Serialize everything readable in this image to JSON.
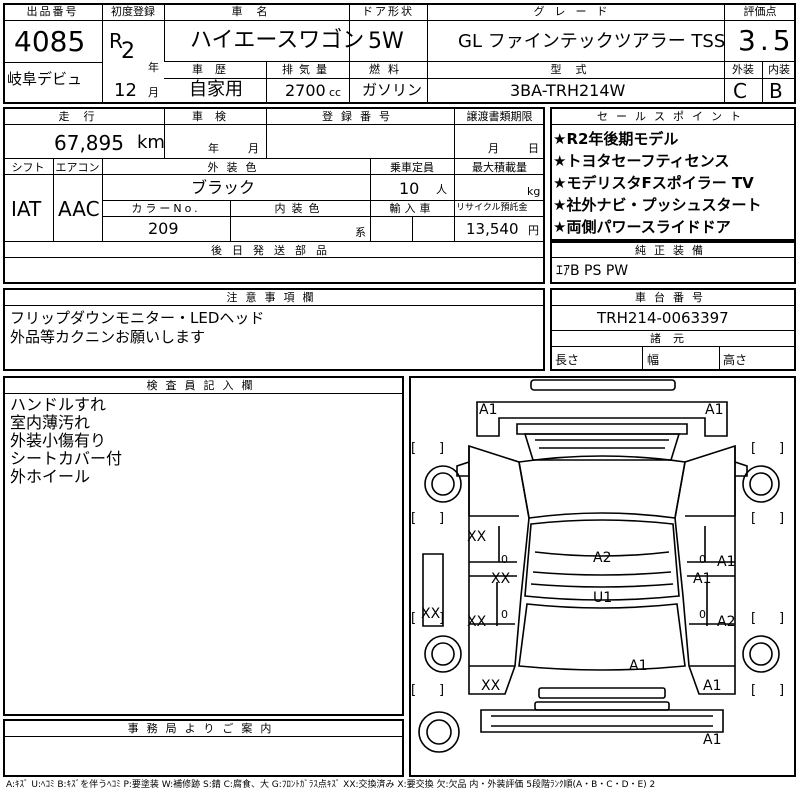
{
  "top": {
    "lot_label": "出品番号",
    "lot": "4085",
    "reg_label": "初度登録",
    "era": "R",
    "reg_year": "2",
    "year_unit": "年",
    "reg_month": "12",
    "month_unit": "月",
    "car_name_label": "車名",
    "car_name": "ハイエースワゴン",
    "door_label": "ドア形状",
    "door": "5W",
    "grade_label": "グレード",
    "grade": "GL ファインテックツアラー TSS",
    "score_label": "評価点",
    "score": "3.5",
    "venue": "岐阜デビュ",
    "history_label": "車歴",
    "history": "自家用",
    "displacement_label": "排気量",
    "displacement": "2700",
    "cc": "cc",
    "fuel_label": "燃料",
    "fuel": "ガソリン",
    "model_label": "型式",
    "model": "3BA-TRH214W",
    "exterior_label": "外装",
    "exterior": "C",
    "interior_label": "内装",
    "interior": "B"
  },
  "mid": {
    "mileage_label": "走行",
    "mileage": "67,895",
    "km": "km",
    "inspection_label": "車検",
    "insp_year_unit": "年",
    "insp_month_unit": "月",
    "plate_label": "登録番号",
    "transfer_label": "譲渡書類期限",
    "transfer_month_unit": "月",
    "transfer_day_unit": "日",
    "shift_label": "シフト",
    "shift": "IAT",
    "ac_label": "エアコン",
    "ac": "AAC",
    "color_label": "外装色",
    "color": "ブラック",
    "capacity_label": "乗車定員",
    "capacity": "10",
    "capacity_unit": "人",
    "load_label": "最大積載量",
    "load_unit": "kg",
    "color_no_label": "カラーNo.",
    "color_no": "209",
    "int_color_label": "内装色",
    "int_color_unit": "系",
    "import_label": "輸入車",
    "recycle_label": "リサイクル預託金",
    "recycle": "13,540",
    "recycle_unit": "円",
    "later_parts_label": "後日発送部品"
  },
  "sales": {
    "title": "セールスポイント",
    "items": [
      "★R2年後期モデル",
      "★トヨタセーフティセンス",
      "★モデリスタFスポイラー TV",
      "★社外ナビ・プッシュスタート",
      "★両側パワースライドドア"
    ]
  },
  "equip": {
    "title": "純正装備",
    "value": "ｴｱB PS PW"
  },
  "caution": {
    "title": "注意事項欄",
    "lines": [
      "フリップダウンモニター・LEDヘッド",
      "外品等カクニンお願いします"
    ]
  },
  "chassis": {
    "title": "車台番号",
    "value": "TRH214-0063397"
  },
  "dims": {
    "title": "諸元",
    "length": "長さ",
    "width": "幅",
    "height": "高さ"
  },
  "inspector": {
    "title": "検査員記入欄",
    "lines": [
      "ハンドルすれ",
      "室内薄汚れ",
      "外装小傷有り",
      "シートカバー付",
      "外ホイール"
    ]
  },
  "office": {
    "title": "事務局よりご案内"
  },
  "diagram_marks": [
    "A1",
    "A1",
    "XX",
    "A2",
    "A1",
    "XX",
    "A1",
    "U1",
    "XX",
    "XX",
    "A2",
    "A1",
    "XX",
    "A1",
    "A1",
    "0",
    "0",
    "0",
    "0"
  ],
  "legend": "A:ｷｽﾞ U:ﾍｺﾐ B:ｷｽﾞを伴うﾍｺﾐ P:要塗装 W:補修跡 S:錆 C:腐食、大 G:ﾌﾛﾝﾄｶﾞﾗｽ点ｷｽﾞ XX:交換済み X:要交換 欠:欠品 内・外装評価 5段階ﾗﾝｸ順(A・B・C・D・E) 2"
}
